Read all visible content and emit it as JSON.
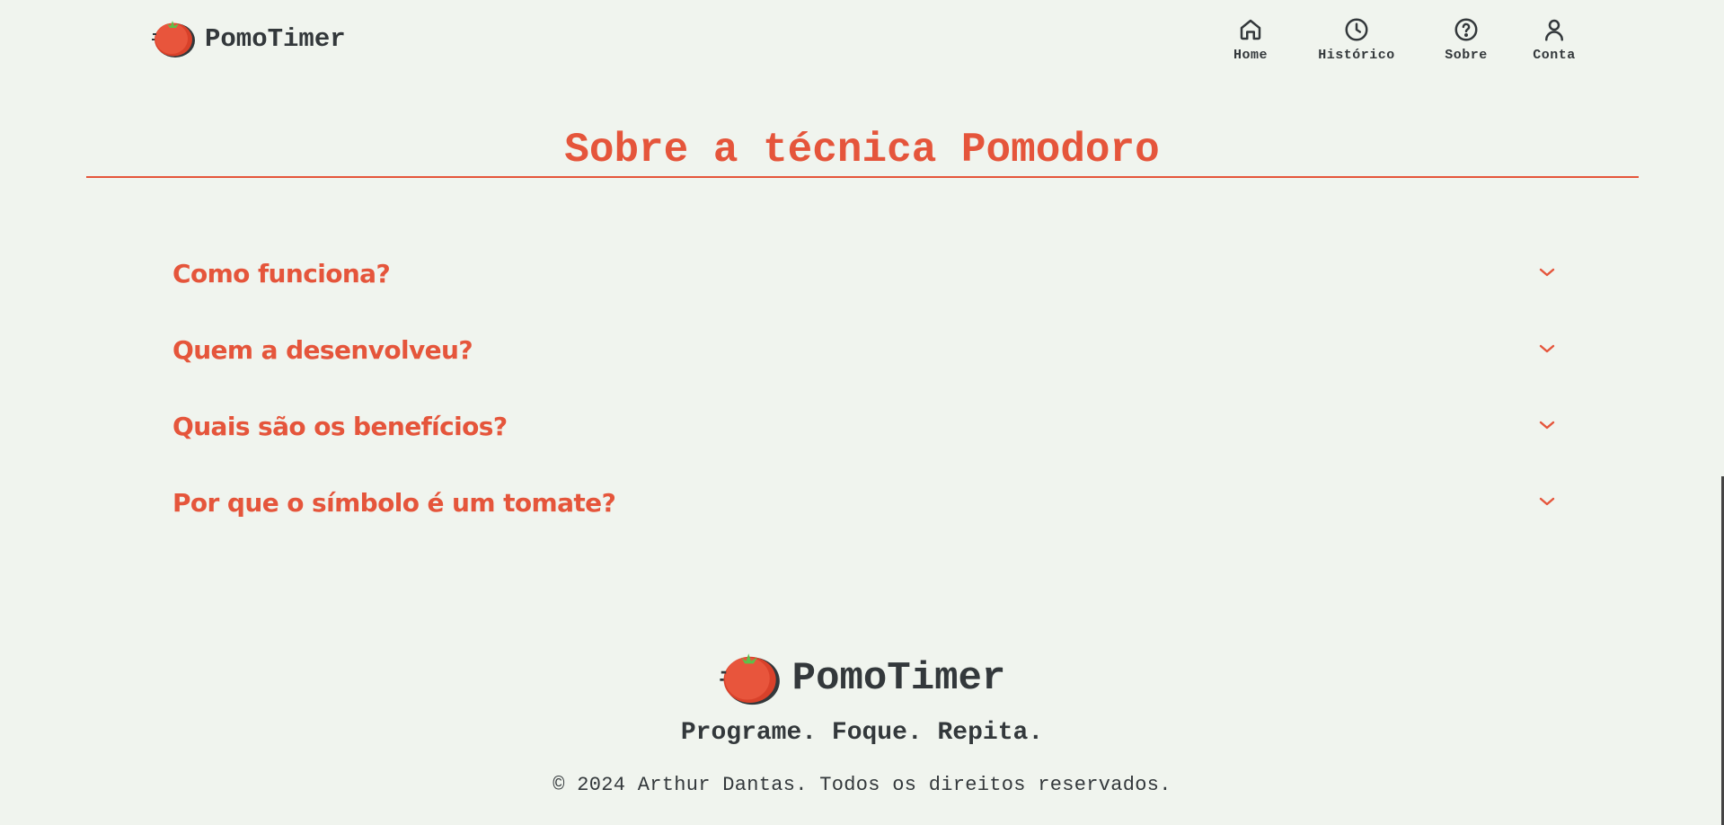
{
  "header": {
    "brand_name": "PomoTimer",
    "nav": [
      {
        "label": "Home",
        "icon": "home-icon"
      },
      {
        "label": "Histórico",
        "icon": "clock-icon"
      },
      {
        "label": "Sobre",
        "icon": "help-circle-icon"
      },
      {
        "label": "Conta",
        "icon": "user-icon"
      }
    ]
  },
  "main": {
    "title": "Sobre a técnica Pomodoro",
    "faq": [
      {
        "question": "Como funciona?"
      },
      {
        "question": "Quem a desenvolveu?"
      },
      {
        "question": "Quais são os benefícios?"
      },
      {
        "question": "Por que o símbolo é um tomate?"
      }
    ]
  },
  "footer": {
    "brand_name": "PomoTimer",
    "tagline": "Programe. Foque. Repita.",
    "copyright": "© 2024 Arthur Dantas. Todos os direitos reservados."
  },
  "colors": {
    "background": "#f0f4ee",
    "accent": "#e5553b",
    "text": "#33383b",
    "leaf": "#5cc14a"
  }
}
